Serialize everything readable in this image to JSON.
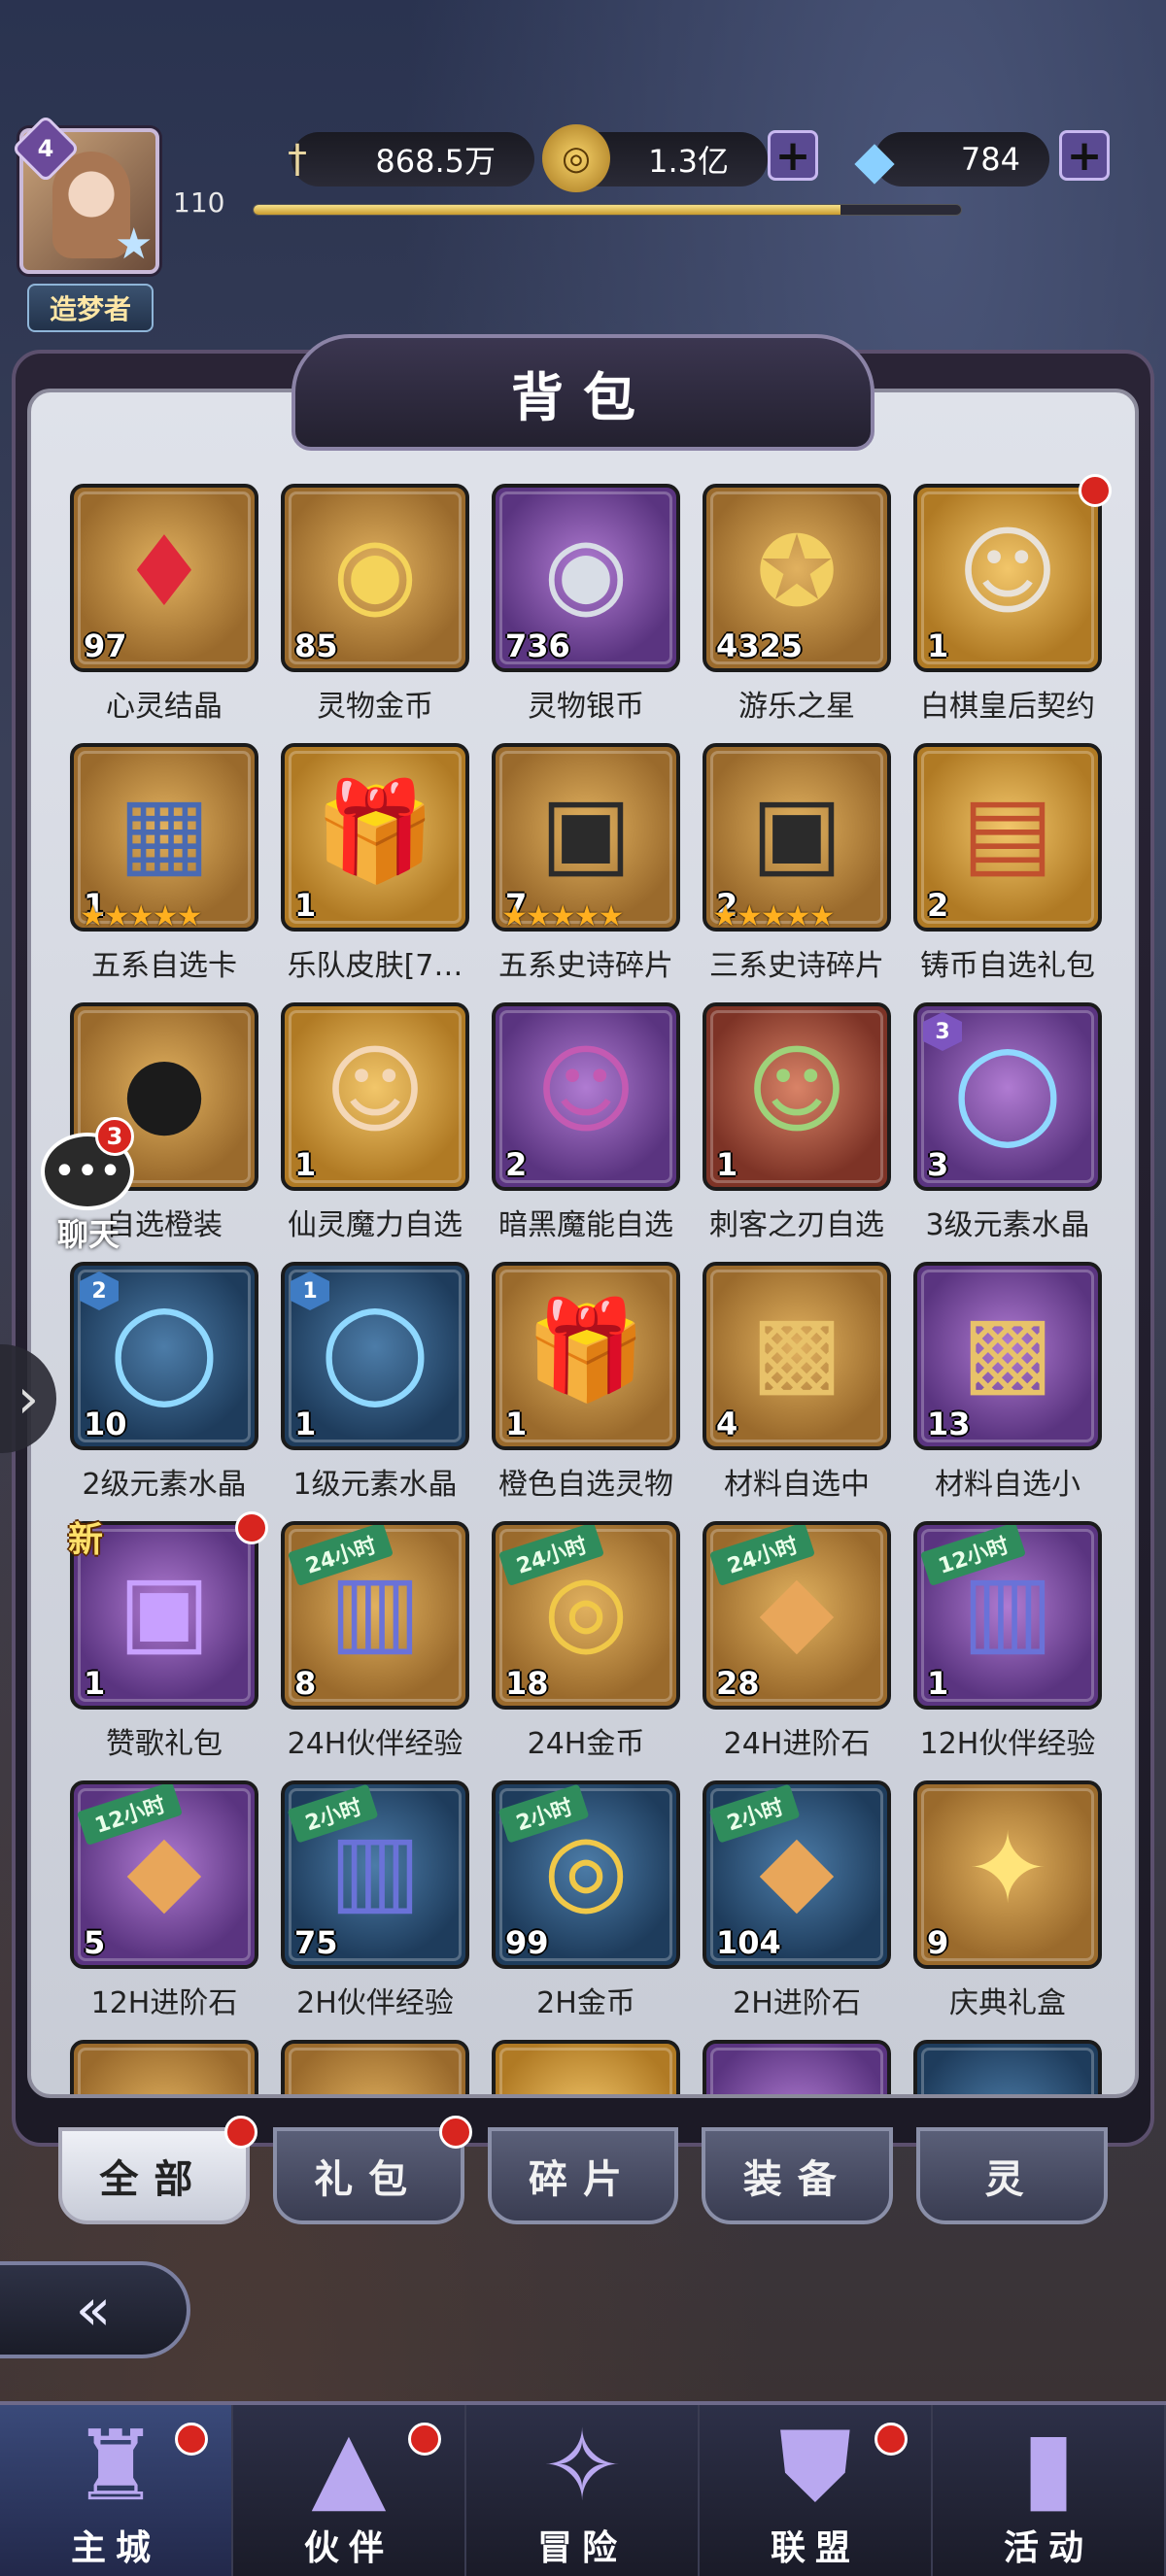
{
  "player": {
    "level": "4",
    "exp_level": "110",
    "exp_progress": 0.83,
    "title": "造梦者"
  },
  "resources": [
    {
      "name": "power",
      "icon": "sword-icon",
      "value": "868.5万",
      "has_plus": false
    },
    {
      "name": "gold",
      "icon": "coin-icon",
      "value": "1.3亿",
      "has_plus": true
    },
    {
      "name": "diamond",
      "icon": "diamond-icon",
      "value": "784",
      "has_plus": true
    }
  ],
  "panel": {
    "title": "背包"
  },
  "items": [
    {
      "name": "心灵结晶",
      "count": "97",
      "tile": "gold",
      "icon": "crystal-icon"
    },
    {
      "name": "灵物金币",
      "count": "85",
      "tile": "gold",
      "icon": "gold-medal-icon"
    },
    {
      "name": "灵物银币",
      "count": "736",
      "tile": "purple",
      "icon": "silver-medal-icon"
    },
    {
      "name": "游乐之星",
      "count": "4325",
      "tile": "gold",
      "icon": "star-coin-icon"
    },
    {
      "name": "白棋皇后契约",
      "count": "1",
      "tile": "orange",
      "icon": "puzzle-portrait-icon",
      "dot": true
    },
    {
      "name": "五系自选卡",
      "count": "1",
      "tile": "gold",
      "icon": "card-icon",
      "stars": "★★★★★"
    },
    {
      "name": "乐队皮肤[7…",
      "count": "1",
      "tile": "orange",
      "icon": "gift-box-icon"
    },
    {
      "name": "五系史诗碎片",
      "count": "7",
      "tile": "gold",
      "icon": "treasure-chest-icon",
      "stars": "★★★★★"
    },
    {
      "name": "三系史诗碎片",
      "count": "2",
      "tile": "gold",
      "icon": "treasure-chest-icon",
      "stars": "★★★★★"
    },
    {
      "name": "铸币自选礼包",
      "count": "2",
      "tile": "orange",
      "icon": "chest-icon"
    },
    {
      "name": "自选橙装",
      "count": "",
      "tile": "gold",
      "icon": "shadow-orb-icon"
    },
    {
      "name": "仙灵魔力自选",
      "count": "1",
      "tile": "orange",
      "icon": "fairy-portrait-icon"
    },
    {
      "name": "暗黑魔能自选",
      "count": "2",
      "tile": "purple",
      "icon": "dark-portrait-icon"
    },
    {
      "name": "刺客之刃自选",
      "count": "1",
      "tile": "red",
      "icon": "assassin-portrait-icon"
    },
    {
      "name": "3级元素水晶",
      "count": "3",
      "tile": "purple",
      "icon": "crystal-ball-icon",
      "grade": "3",
      "grade_color": "purple"
    },
    {
      "name": "2级元素水晶",
      "count": "10",
      "tile": "blue",
      "icon": "crystal-ball-icon",
      "grade": "2",
      "grade_color": "blue"
    },
    {
      "name": "1级元素水晶",
      "count": "1",
      "tile": "blue",
      "icon": "crystal-ball-icon",
      "grade": "1",
      "grade_color": "blue"
    },
    {
      "name": "橙色自选灵物",
      "count": "1",
      "tile": "gold",
      "icon": "gift-box-icon"
    },
    {
      "name": "材料自选中",
      "count": "4",
      "tile": "gold",
      "icon": "gift-pile-icon"
    },
    {
      "name": "材料自选小",
      "count": "13",
      "tile": "purple",
      "icon": "gift-pile-icon"
    },
    {
      "name": "赞歌礼包",
      "count": "1",
      "tile": "purple",
      "icon": "purple-gift-icon",
      "new": "新",
      "dot": true
    },
    {
      "name": "24H伙伴经验",
      "count": "8",
      "tile": "gold",
      "icon": "exp-box-icon",
      "time": "24小时"
    },
    {
      "name": "24H金币",
      "count": "18",
      "tile": "gold",
      "icon": "coins-icon",
      "time": "24小时"
    },
    {
      "name": "24H进阶石",
      "count": "28",
      "tile": "gold",
      "icon": "stones-icon",
      "time": "24小时"
    },
    {
      "name": "12H伙伴经验",
      "count": "1",
      "tile": "purple",
      "icon": "exp-box-icon",
      "time": "12小时"
    },
    {
      "name": "12H进阶石",
      "count": "5",
      "tile": "purple",
      "icon": "stones-icon",
      "time": "12小时"
    },
    {
      "name": "2H伙伴经验",
      "count": "75",
      "tile": "blue",
      "icon": "exp-box-icon",
      "time": "2小时"
    },
    {
      "name": "2H金币",
      "count": "99",
      "tile": "blue",
      "icon": "coins-icon",
      "time": "2小时"
    },
    {
      "name": "2H进阶石",
      "count": "104",
      "tile": "blue",
      "icon": "stones-icon",
      "time": "2小时"
    },
    {
      "name": "庆典礼盒",
      "count": "9",
      "tile": "gold",
      "icon": "celebration-box-icon"
    },
    {
      "name": "",
      "count": "",
      "tile": "gold",
      "icon": "item-icon"
    },
    {
      "name": "",
      "count": "",
      "tile": "gold",
      "icon": "item-icon"
    },
    {
      "name": "",
      "count": "",
      "tile": "orange",
      "icon": "item-icon"
    },
    {
      "name": "",
      "count": "",
      "tile": "purple",
      "icon": "item-icon"
    },
    {
      "name": "",
      "count": "",
      "tile": "blue",
      "icon": "item-icon"
    }
  ],
  "tabs": [
    {
      "label": "全部",
      "active": true,
      "dot": true
    },
    {
      "label": "礼包",
      "active": false,
      "dot": true
    },
    {
      "label": "碎片",
      "active": false,
      "dot": false
    },
    {
      "label": "装备",
      "active": false,
      "dot": false
    },
    {
      "label": "灵",
      "active": false,
      "dot": false
    }
  ],
  "chat": {
    "label": "聊天",
    "count": "3"
  },
  "nav": [
    {
      "label": "主城",
      "icon": "castle-icon",
      "active": true,
      "dot": true
    },
    {
      "label": "伙伴",
      "icon": "wizard-hat-icon",
      "active": false,
      "dot": true
    },
    {
      "label": "冒险",
      "icon": "compass-icon",
      "active": false,
      "dot": false
    },
    {
      "label": "联盟",
      "icon": "shield-icon",
      "active": false,
      "dot": true
    },
    {
      "label": "活动",
      "icon": "cards-icon",
      "active": false,
      "dot": false
    }
  ],
  "colors": {
    "accent": "#5a4a92",
    "red_dot": "#d8251f",
    "exp": "#e8c552"
  }
}
